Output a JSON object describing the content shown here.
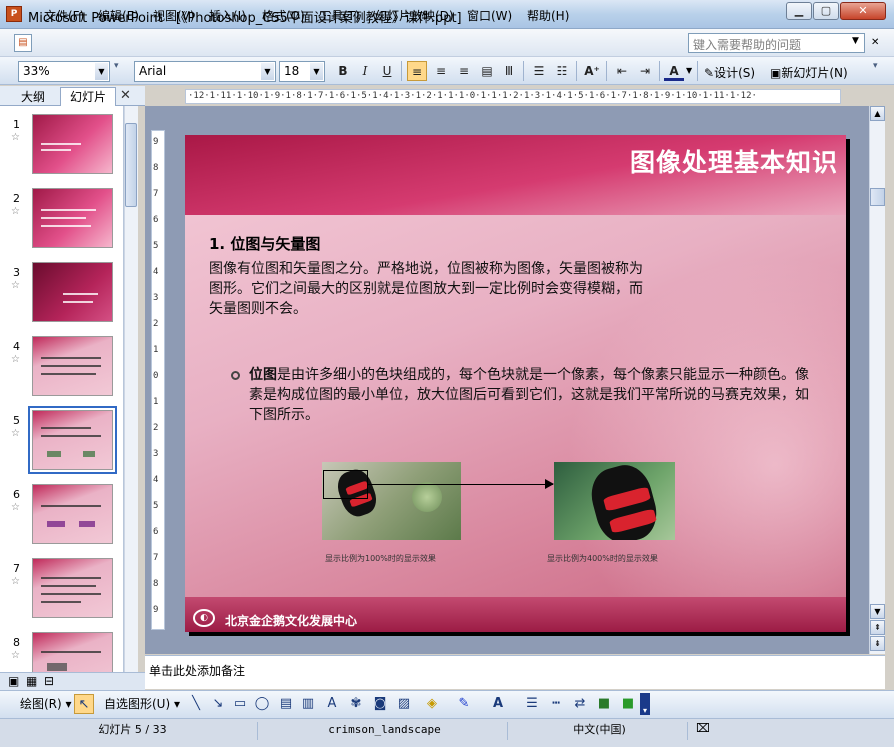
{
  "window": {
    "title": "Microsoft PowerPoint - [《Photoshop_CS5平面设计案例教程》课件.ppt]",
    "app_icon": "powerpoint-icon"
  },
  "menu": [
    "文件(F)",
    "编辑(E)",
    "视图(V)",
    "插入(I)",
    "格式(O)",
    "工具(T)",
    "幻灯片放映(D)",
    "窗口(W)",
    "帮助(H)"
  ],
  "help_placeholder": "键入需要帮助的问题",
  "toolbar": {
    "zoom": "33%",
    "font": "Arial",
    "size": "18",
    "design_label": "设计(S)",
    "new_slide_label": "新幻灯片(N)"
  },
  "panel": {
    "tab_outline": "大纲",
    "tab_slides": "幻灯片",
    "thumbnails": [
      "1",
      "2",
      "3",
      "4",
      "5",
      "6",
      "7",
      "8"
    ],
    "selected": 5
  },
  "ruler": {
    "horizontal": "·12·1·11·1·10·1·9·1·8·1·7·1·6·1·5·1·4·1·3·1·2·1·1·1·0·1·1·1·2·1·3·1·4·1·5·1·6·1·7·1·8·1·9·1·10·1·11·1·12·",
    "vertical": [
      "9",
      "8",
      "7",
      "6",
      "5",
      "4",
      "3",
      "2",
      "1",
      "0",
      "1",
      "2",
      "3",
      "4",
      "5",
      "6",
      "7",
      "8",
      "9"
    ]
  },
  "slide": {
    "title": "图像处理基本知识",
    "section_heading": "1. 位图与矢量图",
    "section_body": "图像有位图和矢量图之分。严格地说，位图被称为图像，矢量图被称为图形。它们之间最大的区别就是位图放大到一定比例时会变得模糊，而矢量图则不会。",
    "bullet_bold": "位图",
    "bullet_rest": "是由许多细小的色块组成的，每个色块就是一个像素，每个像素只能显示一种颜色。像素是构成位图的最小单位，放大位图后可看到它们，这就是我们平常所说的马赛克效果，如下图所示。",
    "caption_small": "显示比例为100%时的显示效果",
    "caption_large": "显示比例为400%时的显示效果",
    "footer": "北京金企鹅文化发展中心"
  },
  "notes_placeholder": "单击此处添加备注",
  "drawbar": {
    "draw_label": "绘图(R)",
    "autoshape_label": "自选图形(U)"
  },
  "status": {
    "slide_pos": "幻灯片 5 / 33",
    "design": "crimson_landscape",
    "language": "中文(中国)"
  }
}
